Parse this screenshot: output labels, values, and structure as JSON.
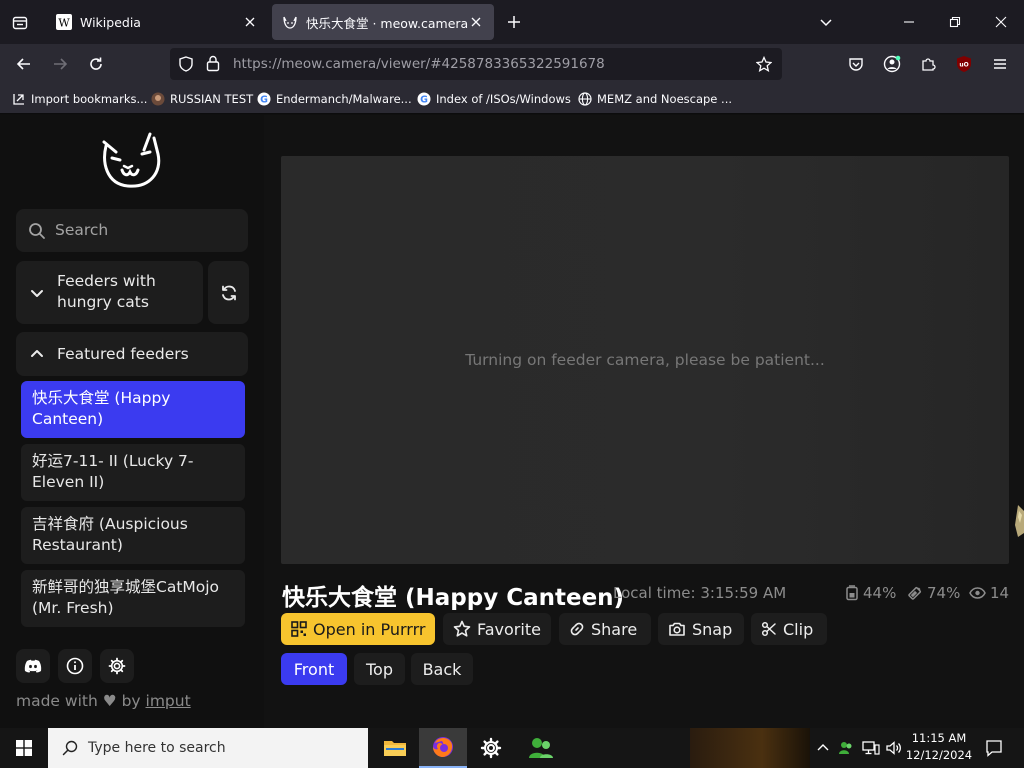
{
  "browser": {
    "tabs": [
      {
        "title": "Wikipedia",
        "favicon": "wikipedia-w-icon"
      },
      {
        "title": "快乐大食堂 · meow.camera",
        "favicon": "cat-face-icon",
        "active": true
      }
    ],
    "url": {
      "host": "https://meow.camera",
      "path": "/viewer/#4258783365322591678"
    },
    "bookmarks": [
      {
        "label": "Import bookmarks...",
        "icon": "import-icon"
      },
      {
        "label": "RUSSIAN TEST",
        "icon": "avatar-icon"
      },
      {
        "label": "Endermanch/Malware...",
        "icon": "google-icon"
      },
      {
        "label": "Index of /ISOs/Windows",
        "icon": "google-icon"
      },
      {
        "label": "MEMZ and Noescape ...",
        "icon": "globe-icon"
      }
    ]
  },
  "sidebar": {
    "search_placeholder": "Search",
    "groups": [
      {
        "label": "Feeders with hungry cats",
        "expanded": false
      },
      {
        "label": "Featured feeders",
        "expanded": true
      }
    ],
    "feeders": [
      {
        "name": "快乐大食堂 (Happy Canteen)",
        "active": true
      },
      {
        "name": "好运7-11- II (Lucky 7-Eleven II)"
      },
      {
        "name": "吉祥食府 (Auspicious Restaurant)"
      },
      {
        "name": "新鲜哥的独享城堡CatMojo (Mr. Fresh)"
      }
    ],
    "footer": {
      "made_with": "made with",
      "by": "by",
      "author": "imput"
    }
  },
  "viewer": {
    "status": "Turning on feeder camera, please be patient...",
    "title": "快乐大食堂 (Happy Canteen)",
    "local_time": "Local time: 3:15:59 AM",
    "stats": {
      "food": "44%",
      "battery": "74%",
      "viewers": "14"
    },
    "actions": [
      "Open in Purrrr",
      "Favorite",
      "Share",
      "Snap",
      "Clip"
    ],
    "views": [
      {
        "label": "Front",
        "active": true
      },
      {
        "label": "Top"
      },
      {
        "label": "Back"
      }
    ]
  },
  "taskbar": {
    "search_placeholder": "Type here to search",
    "time": "11:15 AM",
    "date": "12/12/2024"
  },
  "colors": {
    "accent": "#3b3bf0",
    "purrrr": "#f7c42e"
  }
}
